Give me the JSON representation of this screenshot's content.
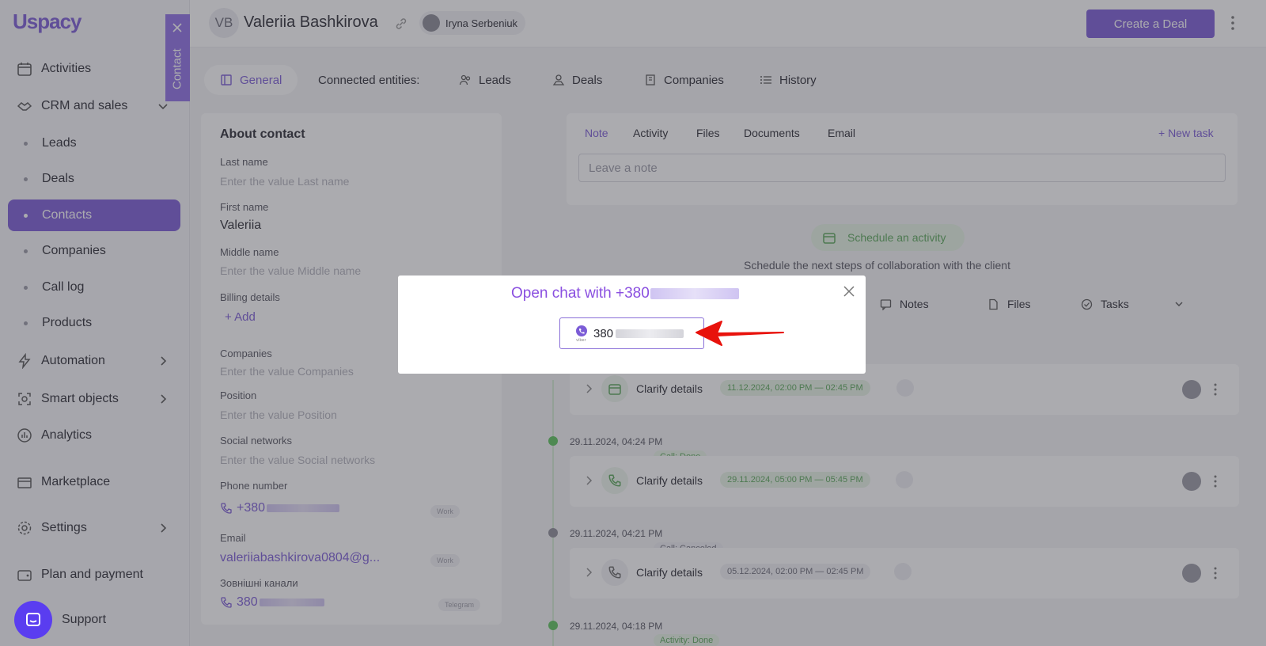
{
  "app": {
    "logo": "Uspacy"
  },
  "sidebar": {
    "items": [
      {
        "label": "Activities",
        "icon": "calendar-icon"
      },
      {
        "label": "CRM and sales",
        "icon": "handshake-icon"
      },
      {
        "label": "Leads"
      },
      {
        "label": "Deals"
      },
      {
        "label": "Contacts",
        "active": true
      },
      {
        "label": "Companies"
      },
      {
        "label": "Call log"
      },
      {
        "label": "Products"
      },
      {
        "label": "Automation",
        "icon": "lightning-icon"
      },
      {
        "label": "Smart objects",
        "icon": "smart-objects-icon"
      },
      {
        "label": "Analytics",
        "icon": "analytics-icon"
      },
      {
        "label": "Marketplace",
        "icon": "marketplace-icon"
      },
      {
        "label": "Settings",
        "icon": "gear-icon"
      },
      {
        "label": "Plan and payment",
        "icon": "wallet-icon"
      },
      {
        "label": "Support",
        "icon": "support-icon"
      }
    ],
    "contact_tab_label": "Contact"
  },
  "header": {
    "initials": "VB",
    "name": "Valeriia Bashkirova",
    "owner": "Iryna Serbeniuk",
    "create_deal_label": "Create a Deal"
  },
  "tabs": [
    {
      "label": "General",
      "active": true
    },
    {
      "label": "Connected entities:"
    },
    {
      "label": "Leads"
    },
    {
      "label": "Deals"
    },
    {
      "label": "Companies"
    },
    {
      "label": "History"
    }
  ],
  "about": {
    "title": "About contact",
    "last_name_label": "Last name",
    "last_name_placeholder": "Enter the value Last name",
    "first_name_label": "First name",
    "first_name_value": "Valeriia",
    "middle_name_label": "Middle name",
    "middle_name_placeholder": "Enter the value Middle name",
    "billing_label": "Billing details",
    "add_label": "+ Add",
    "companies_label": "Companies",
    "companies_placeholder": "Enter the value Companies",
    "position_label": "Position",
    "position_placeholder": "Enter the value Position",
    "social_label": "Social networks",
    "social_placeholder": "Enter the value Social networks",
    "phone_label": "Phone number",
    "phone_value": "+380",
    "phone_tag": "Work",
    "email_label": "Email",
    "email_value": "valeriiabashkirova0804@g...",
    "email_tag": "Work",
    "external_label": "Зовнішні канали",
    "external_value": "380",
    "external_tag": "Telegram"
  },
  "note_card": {
    "tabs": [
      "Note",
      "Activity",
      "Files",
      "Documents",
      "Email"
    ],
    "new_task_label": "+ New task",
    "note_placeholder": "Leave a note"
  },
  "schedule": {
    "button_label": "Schedule an activity",
    "hint": "Schedule the next steps of collaboration with the client"
  },
  "filters": [
    "Notes",
    "Files",
    "Tasks"
  ],
  "timeline": [
    {
      "date": "",
      "status": "",
      "title": "Clarify details",
      "range": "11.12.2024, 02:00 PM — 02:45 PM",
      "type": "calendar"
    },
    {
      "date": "29.11.2024, 04:24 PM",
      "status": "Call: Done",
      "title": "Clarify details",
      "range": "29.11.2024, 05:00 PM — 05:45 PM",
      "type": "call"
    },
    {
      "date": "29.11.2024, 04:21 PM",
      "status": "Call: Canceled",
      "title": "Clarify details",
      "range": "05.12.2024, 02:00 PM — 02:45 PM",
      "type": "call"
    },
    {
      "date": "29.11.2024, 04:18 PM",
      "status": "Activity: Done"
    }
  ],
  "modal": {
    "title": "Open chat with +380",
    "option_value": "380"
  },
  "colors": {
    "accent": "#7b5cd6",
    "modal_title": "#8a4fe0",
    "green": "#5aa85a",
    "overlay": "rgba(60,60,70,0.43)",
    "arrow": "#e8120c"
  }
}
